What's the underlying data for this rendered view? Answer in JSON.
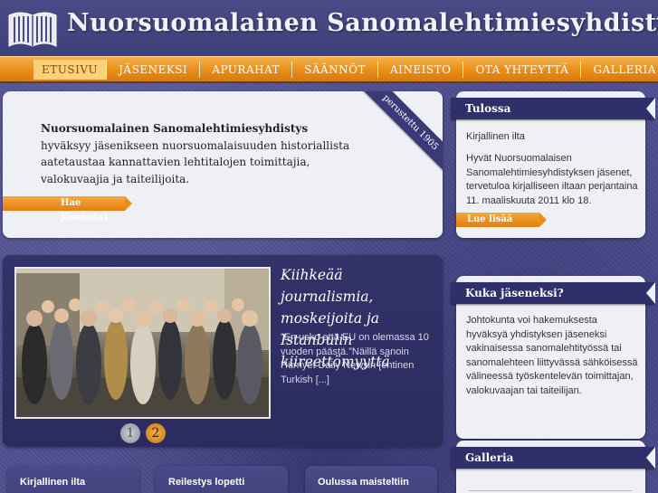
{
  "header": {
    "title": "Nuorsuomalainen Sanomalehtimiesyhdistys"
  },
  "nav": {
    "items": [
      "ETUSIVU",
      "JÄSENEKSI",
      "APURAHAT",
      "SÄÄNNÖT",
      "AINEISTO",
      "OTA YHTEYTTÄ",
      "GALLERIA"
    ],
    "active": "ETUSIVU"
  },
  "intro": {
    "name": "Nuorsuomalainen Sanomalehtimiesyhdistys",
    "text": " hyväksyy jäsenikseen nuorsuomalaisuuden historiallista aatetaustaa kannattavien lehtitalojen toimittajia, valokuvaajia ja taiteilijoita.",
    "ribbon": "perustettu 1905",
    "button": "Hae jäseneksi"
  },
  "slider": {
    "title": "Kiihkeää journalismia, moskeijoita ja Istanbulin kiireettömyyttä",
    "excerpt": "”En usko että EU on olemassa 10 vuoden päästä.”Näillä sanoin Hürriyet Daily Newsin [entinen Turkish [...]",
    "dots": [
      "1",
      "2"
    ],
    "active_dot": 2
  },
  "cards": [
    "Kirjallinen ilta",
    "Reilestys lopetti",
    "Oulussa maisteltiin"
  ],
  "sidebar": {
    "tulossa": {
      "heading": "Tulossa",
      "event_title": "Kirjallinen ilta",
      "event_body": "Hyvät Nuorsuomalaisen Sanomalehtimiesyhdistyksen jäsenet, tervetuloa kirjalliseen iltaan perjantaina 11. maaliskuuta 2011 klo 18.",
      "button": "Lue lisää"
    },
    "kuka": {
      "heading": "Kuka jäseneksi?",
      "body": "Johtokunta voi hakemuksesta hyväksyä yhdistyksen jäseneksi vakinaisessa sanomalehtityössä tai sanomalehteen liittyvässä sähköisessä välineessä työskentelevän toimittajan, valokuvaajan tai taiteilijan."
    },
    "galleria": {
      "heading": "Galleria"
    }
  },
  "colors": {
    "background": "#4f4f8f",
    "nav_orange": "#e98d18",
    "panel": "#eef0f5",
    "dark_band": "#2f2f6a"
  }
}
